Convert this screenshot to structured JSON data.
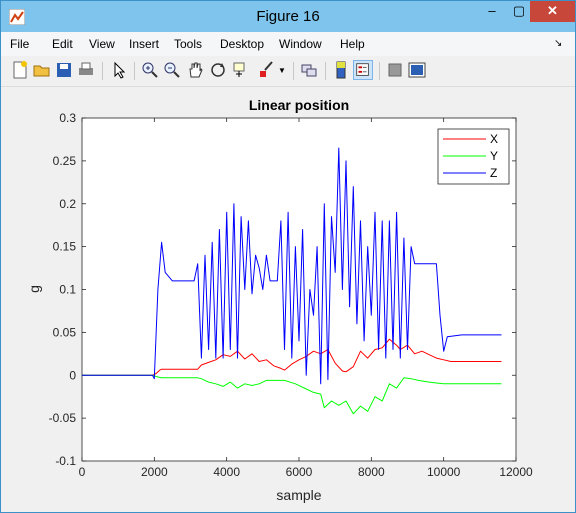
{
  "window": {
    "title": "Figure 16",
    "minimize": "–",
    "maximize": "▢",
    "close": "✕"
  },
  "menu": [
    "File",
    "Edit",
    "View",
    "Insert",
    "Tools",
    "Desktop",
    "Window",
    "Help"
  ],
  "toolbar_icons": [
    "new-figure-icon",
    "open-file-icon",
    "save-icon",
    "print-icon",
    "pointer-icon",
    "zoom-in-icon",
    "zoom-out-icon",
    "pan-icon",
    "rotate-icon",
    "data-cursor-icon",
    "brush-icon",
    "link-plot-icon",
    "colorbar-icon",
    "legend-icon",
    "hide-plot-tools-icon",
    "show-plot-tools-icon"
  ],
  "chart_data": {
    "type": "line",
    "title": "Linear position",
    "xlabel": "sample",
    "ylabel": "g",
    "xlim": [
      0,
      12000
    ],
    "ylim": [
      -0.1,
      0.3
    ],
    "xticks": [
      "0",
      "2000",
      "4000",
      "6000",
      "8000",
      "10000",
      "12000"
    ],
    "yticks": [
      "-0.1",
      "-0.05",
      "0",
      "0.05",
      "0.1",
      "0.15",
      "0.2",
      "0.25",
      "0.3"
    ],
    "legend_position": "top-right",
    "series": [
      {
        "name": "X",
        "color": "#ff0000",
        "x": [
          0,
          1950,
          2050,
          2150,
          2200,
          3200,
          3300,
          3500,
          3700,
          3900,
          4100,
          4300,
          4500,
          4700,
          4900,
          5100,
          5300,
          5500,
          5600,
          5800,
          6000,
          6200,
          6400,
          6600,
          6800,
          7000,
          7200,
          7300,
          7500,
          7700,
          7900,
          8100,
          8300,
          8500,
          8700,
          8800,
          9000,
          9200,
          9400,
          9600,
          9800,
          10000,
          10200,
          10500,
          11000,
          11600
        ],
        "y": [
          0,
          0,
          0.002,
          0.006,
          0.007,
          0.007,
          0.012,
          0.015,
          0.018,
          0.024,
          0.022,
          0.028,
          0.019,
          0.025,
          0.016,
          0.018,
          0.011,
          0.008,
          0.006,
          0.013,
          0.018,
          0.022,
          0.028,
          0.025,
          0.03,
          0.014,
          0.005,
          0.004,
          0.01,
          0.028,
          0.02,
          0.03,
          0.032,
          0.042,
          0.035,
          0.03,
          0.035,
          0.025,
          0.028,
          0.024,
          0.02,
          0.018,
          0.016,
          0.016,
          0.016,
          0.016
        ]
      },
      {
        "name": "Y",
        "color": "#00ff00",
        "x": [
          0,
          1950,
          2100,
          2200,
          3200,
          3300,
          3500,
          3700,
          3900,
          4100,
          4300,
          4500,
          4700,
          4900,
          5100,
          5300,
          5600,
          5900,
          6200,
          6400,
          6600,
          6700,
          6900,
          7100,
          7300,
          7500,
          7700,
          7900,
          8100,
          8300,
          8500,
          8700,
          8900,
          9100,
          9300,
          9600,
          9800,
          10000,
          10500,
          11000,
          11600
        ],
        "y": [
          0,
          0,
          -0.002,
          -0.003,
          -0.003,
          -0.004,
          -0.008,
          -0.01,
          -0.013,
          -0.008,
          -0.015,
          -0.01,
          -0.012,
          -0.01,
          -0.006,
          -0.006,
          -0.006,
          -0.01,
          -0.016,
          -0.02,
          -0.022,
          -0.038,
          -0.03,
          -0.035,
          -0.03,
          -0.045,
          -0.036,
          -0.042,
          -0.025,
          -0.03,
          -0.01,
          -0.015,
          -0.003,
          -0.004,
          -0.006,
          -0.008,
          -0.009,
          -0.01,
          -0.01,
          -0.01,
          -0.01
        ]
      },
      {
        "name": "Z",
        "color": "#0000ff",
        "x": [
          0,
          1950,
          2000,
          2100,
          2200,
          2300,
          2500,
          3100,
          3200,
          3300,
          3400,
          3500,
          3600,
          3700,
          3800,
          3900,
          4000,
          4100,
          4200,
          4300,
          4400,
          4500,
          4600,
          4700,
          4800,
          4900,
          5000,
          5100,
          5200,
          5400,
          5500,
          5600,
          5700,
          5800,
          5900,
          6000,
          6100,
          6200,
          6300,
          6400,
          6500,
          6600,
          6700,
          6800,
          6900,
          7000,
          7100,
          7200,
          7300,
          7400,
          7500,
          7600,
          7700,
          7800,
          7900,
          8000,
          8100,
          8200,
          8300,
          8400,
          8500,
          8600,
          8700,
          8800,
          8900,
          9000,
          9100,
          9200,
          9400,
          9600,
          9700,
          9800,
          9900,
          10000,
          10100,
          10500,
          11000,
          11600
        ],
        "y": [
          0,
          0,
          -0.004,
          0.1,
          0.155,
          0.12,
          0.11,
          0.11,
          0.13,
          0.02,
          0.14,
          0.03,
          0.155,
          0.02,
          0.17,
          0.02,
          0.19,
          0.03,
          0.2,
          0.02,
          0.185,
          0.1,
          0.18,
          0.095,
          0.14,
          0.125,
          0.1,
          0.14,
          0.11,
          0.11,
          0.18,
          0.03,
          0.19,
          0.02,
          0.15,
          0.04,
          0.17,
          0.0,
          0.1,
          0.07,
          0.15,
          -0.01,
          0.2,
          -0.005,
          0.185,
          0.12,
          0.265,
          0.1,
          0.25,
          0.08,
          0.22,
          0.06,
          0.18,
          0.04,
          0.15,
          0.07,
          0.19,
          0.03,
          0.18,
          0.02,
          0.18,
          0.03,
          0.19,
          0.02,
          0.16,
          0.03,
          0.15,
          0.13,
          0.13,
          0.13,
          0.13,
          0.13,
          0.07,
          0.028,
          0.045,
          0.047,
          0.047,
          0.047
        ]
      }
    ]
  }
}
